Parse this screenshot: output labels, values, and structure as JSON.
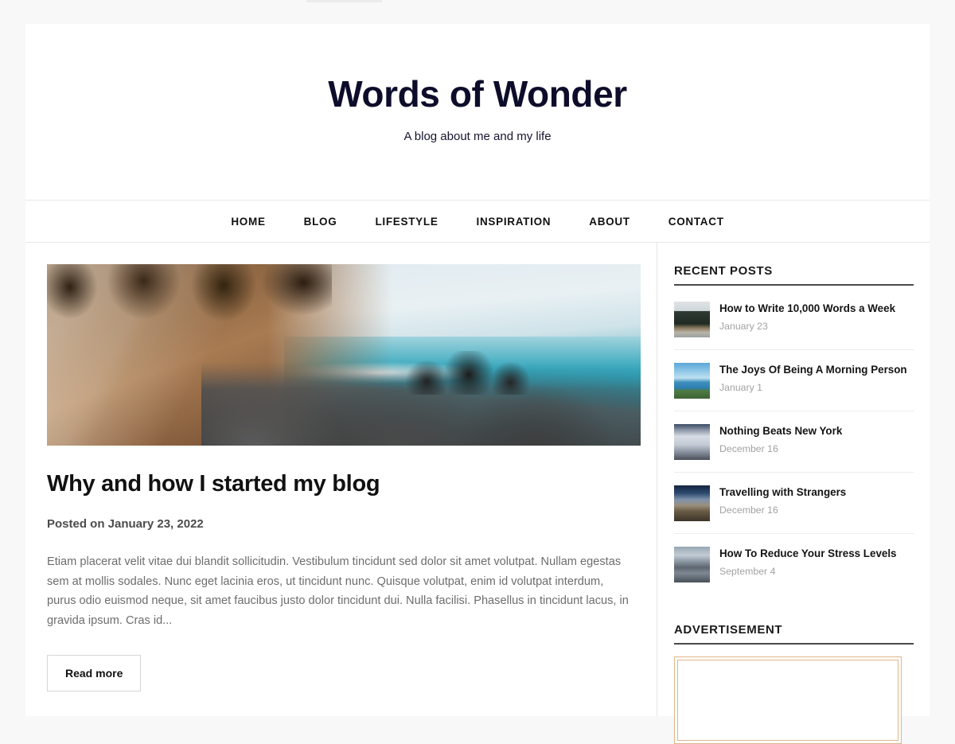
{
  "site": {
    "title": "Words of Wonder",
    "tagline": "A blog about me and my life"
  },
  "nav": {
    "items": [
      {
        "label": "HOME"
      },
      {
        "label": "BLOG"
      },
      {
        "label": "LIFESTYLE"
      },
      {
        "label": "INSPIRATION"
      },
      {
        "label": "ABOUT"
      },
      {
        "label": "CONTACT"
      }
    ]
  },
  "article": {
    "hero_alt": "coastal-forest-ocean-photo",
    "title": "Why and how I started my blog",
    "meta": "Posted on January 23, 2022",
    "excerpt": "Etiam placerat velit vitae dui blandit sollicitudin. Vestibulum tincidunt sed dolor sit amet volutpat. Nullam egestas sem at mollis sodales. Nunc eget lacinia eros, ut tincidunt nunc. Quisque volutpat, enim id volutpat interdum, purus odio euismod neque, sit amet faucibus justo dolor tincidunt dui. Nulla facilisi. Phasellus in tincidunt lacus, in gravida ipsum. Cras id...",
    "read_more_label": "Read more"
  },
  "sidebar": {
    "recent_posts_title": "RECENT POSTS",
    "recent_posts": [
      {
        "title": "How to Write 10,000 Words a Week",
        "date": "January 23",
        "thumb": "th-forest-road"
      },
      {
        "title": "The Joys Of Being A Morning Person",
        "date": "January 1",
        "thumb": "th-coast"
      },
      {
        "title": "Nothing Beats New York",
        "date": "December 16",
        "thumb": "th-clouds"
      },
      {
        "title": "Travelling with Strangers",
        "date": "December 16",
        "thumb": "th-night-road"
      },
      {
        "title": "How To Reduce Your Stress Levels",
        "date": "September 4",
        "thumb": "th-mountain"
      }
    ],
    "advertisement_title": "ADVERTISEMENT"
  },
  "colors": {
    "page_background": "#f8f8f9",
    "content_background": "#ffffff",
    "site_title": "#0d0d2b",
    "nav_text": "#111111",
    "body_text": "#6d6d6d",
    "meta_text": "#4c4c4c",
    "date_text": "#a2a2a2",
    "heading_rule": "#4a4a4a",
    "divider": "#ededed",
    "ad_border": "#e0b48a"
  }
}
